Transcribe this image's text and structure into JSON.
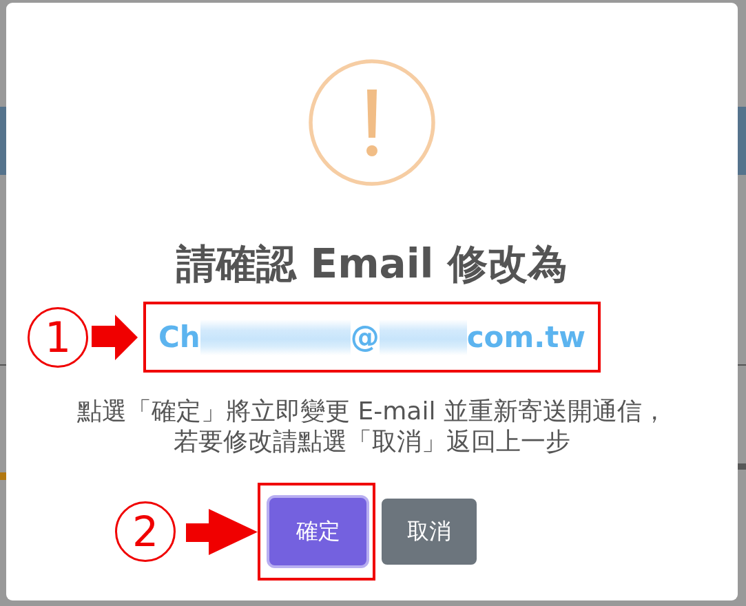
{
  "dialog": {
    "title": "請確認 Email 修改為",
    "email": {
      "annotation": "1",
      "parts": [
        {
          "kind": "text",
          "text": "Ch"
        },
        {
          "kind": "redacted"
        },
        {
          "kind": "text",
          "text": "@"
        },
        {
          "kind": "redacted"
        },
        {
          "kind": "text",
          "text": "com.tw"
        }
      ]
    },
    "message_lines": [
      "點選「確定」將立即變更 E-mail 並重新寄送開通信，",
      "若要修改請點選「取消」返回上一步"
    ],
    "buttons": [
      {
        "label": "確定",
        "kind": "primary",
        "focused": true,
        "annotation": "2"
      },
      {
        "label": "取消",
        "kind": "secondary",
        "focused": false
      }
    ]
  }
}
